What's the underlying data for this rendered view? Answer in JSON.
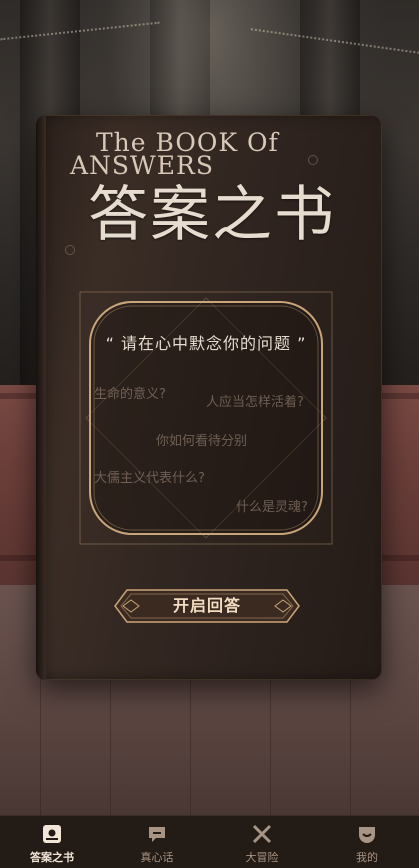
{
  "book": {
    "title_en_line1": "The BOOK Of",
    "title_en_line2": "ANSWERS",
    "title_cn": "答案之书"
  },
  "prompt": "“ 请在心中默念你的问题 ”",
  "sample_questions": [
    "生命的意义?",
    "人应当怎样活着?",
    "你如何看待分别",
    "大儒主义代表什么?",
    "什么是灵魂?"
  ],
  "open_button_label": "开启回答",
  "tabbar": {
    "items": [
      {
        "label": "答案之书",
        "icon": "book-icon",
        "active": true
      },
      {
        "label": "真心话",
        "icon": "chat-bubble-icon",
        "active": false
      },
      {
        "label": "大冒险",
        "icon": "crossed-swords-icon",
        "active": false
      },
      {
        "label": "我的",
        "icon": "profile-icon",
        "active": false
      }
    ]
  },
  "colors": {
    "book_cover": "#2f241f",
    "gold_accent": "#c9a57a",
    "tabbar_bg": "#231b16"
  }
}
